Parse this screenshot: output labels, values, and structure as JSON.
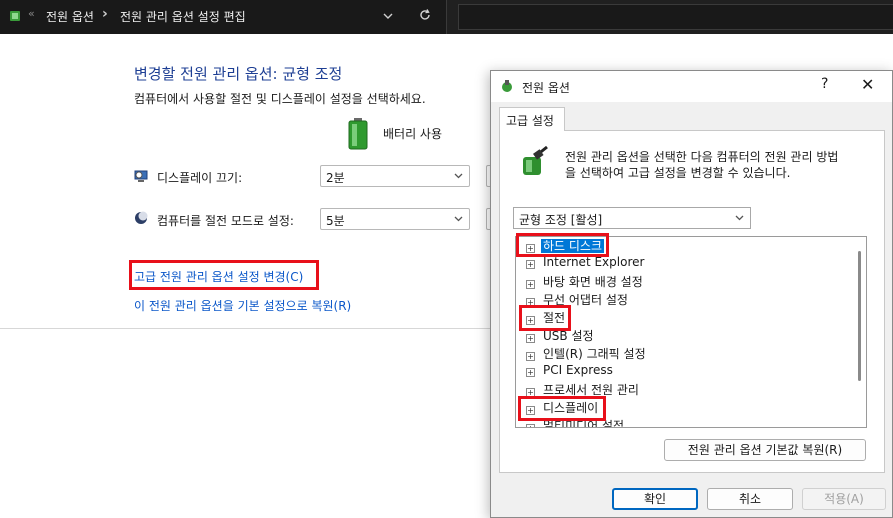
{
  "addressbar": {
    "chevrons": "«",
    "crumb1": "전원 옵션",
    "separator": "›",
    "crumb2": "전원 관리 옵션 설정 편집"
  },
  "main": {
    "title": "변경할 전원 관리 옵션: 균형 조정",
    "description": "컴퓨터에서 사용할 절전 및 디스플레이 설정을 선택하세요.",
    "battery_label": "배터리 사용",
    "display_off_label": "디스플레이 끄기:",
    "display_off_value": "2분",
    "sleep_label": "컴퓨터를 절전 모드로 설정:",
    "sleep_value": "5분",
    "advanced_link": "고급 전원 관리 옵션 설정 변경(C)",
    "restore_link": "이 전원 관리 옵션을 기본 설정으로 복원(R)"
  },
  "dialog": {
    "title": "전원 옵션",
    "help": "?",
    "close": "✕",
    "tab": "고급 설정",
    "info_line1": "전원 관리 옵션을 선택한 다음 컴퓨터의 전원 관리 방법",
    "info_line2": "을 선택하여 고급 설정을 변경할 수 있습니다.",
    "plan_value": "균형 조정 [활성]",
    "tree": [
      {
        "label": "하드 디스크",
        "selected": true
      },
      {
        "label": "Internet Explorer"
      },
      {
        "label": "바탕 화면 배경 설정"
      },
      {
        "label": "무선 어댑터 설정"
      },
      {
        "label": "절전"
      },
      {
        "label": "USB 설정"
      },
      {
        "label": "인텔(R) 그래픽 설정"
      },
      {
        "label": "PCI Express"
      },
      {
        "label": "프로세서 전원 관리"
      },
      {
        "label": "디스플레이"
      },
      {
        "label": "멀티미디어 설정"
      }
    ],
    "restore_button": "전원 관리 옵션 기본값 복원(R)",
    "ok_button": "확인",
    "cancel_button": "취소",
    "apply_button": "적용(A)"
  },
  "colors": {
    "title_blue": "#1e3f94",
    "link_blue": "#0b57c9",
    "highlight_red": "#e8101a",
    "selection_blue": "#0078d7"
  }
}
